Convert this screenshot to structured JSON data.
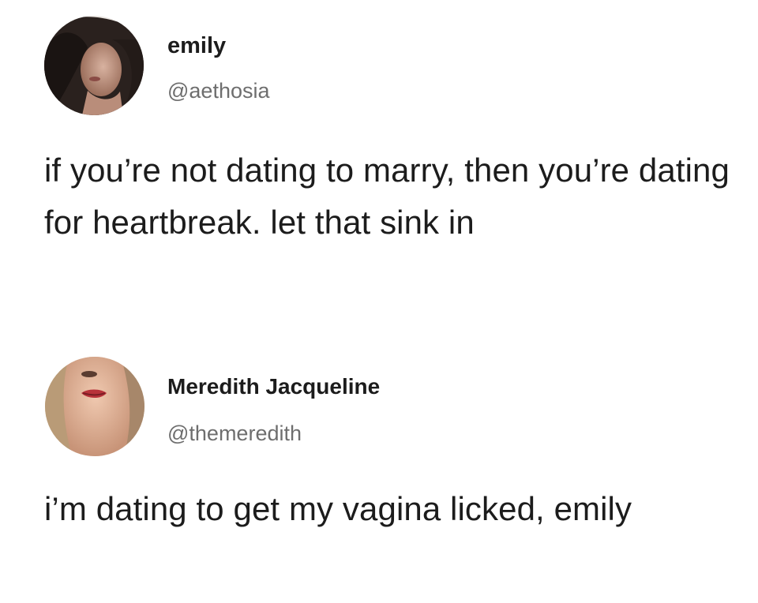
{
  "tweets": [
    {
      "display_name": "emily",
      "handle": "@aethosia",
      "text": "if you’re not dating to marry, then you’re dating for heartbreak. let that sink in",
      "avatar_icon": "profile-photo"
    },
    {
      "display_name": "Meredith Jacqueline",
      "handle": "@themeredith",
      "text": "i’m dating to get my vagina licked, emily",
      "avatar_icon": "profile-photo"
    }
  ],
  "colors": {
    "background": "#ffffff",
    "name": "#1c1c1c",
    "handle": "#6e6e6e",
    "text": "#1c1c1c"
  }
}
